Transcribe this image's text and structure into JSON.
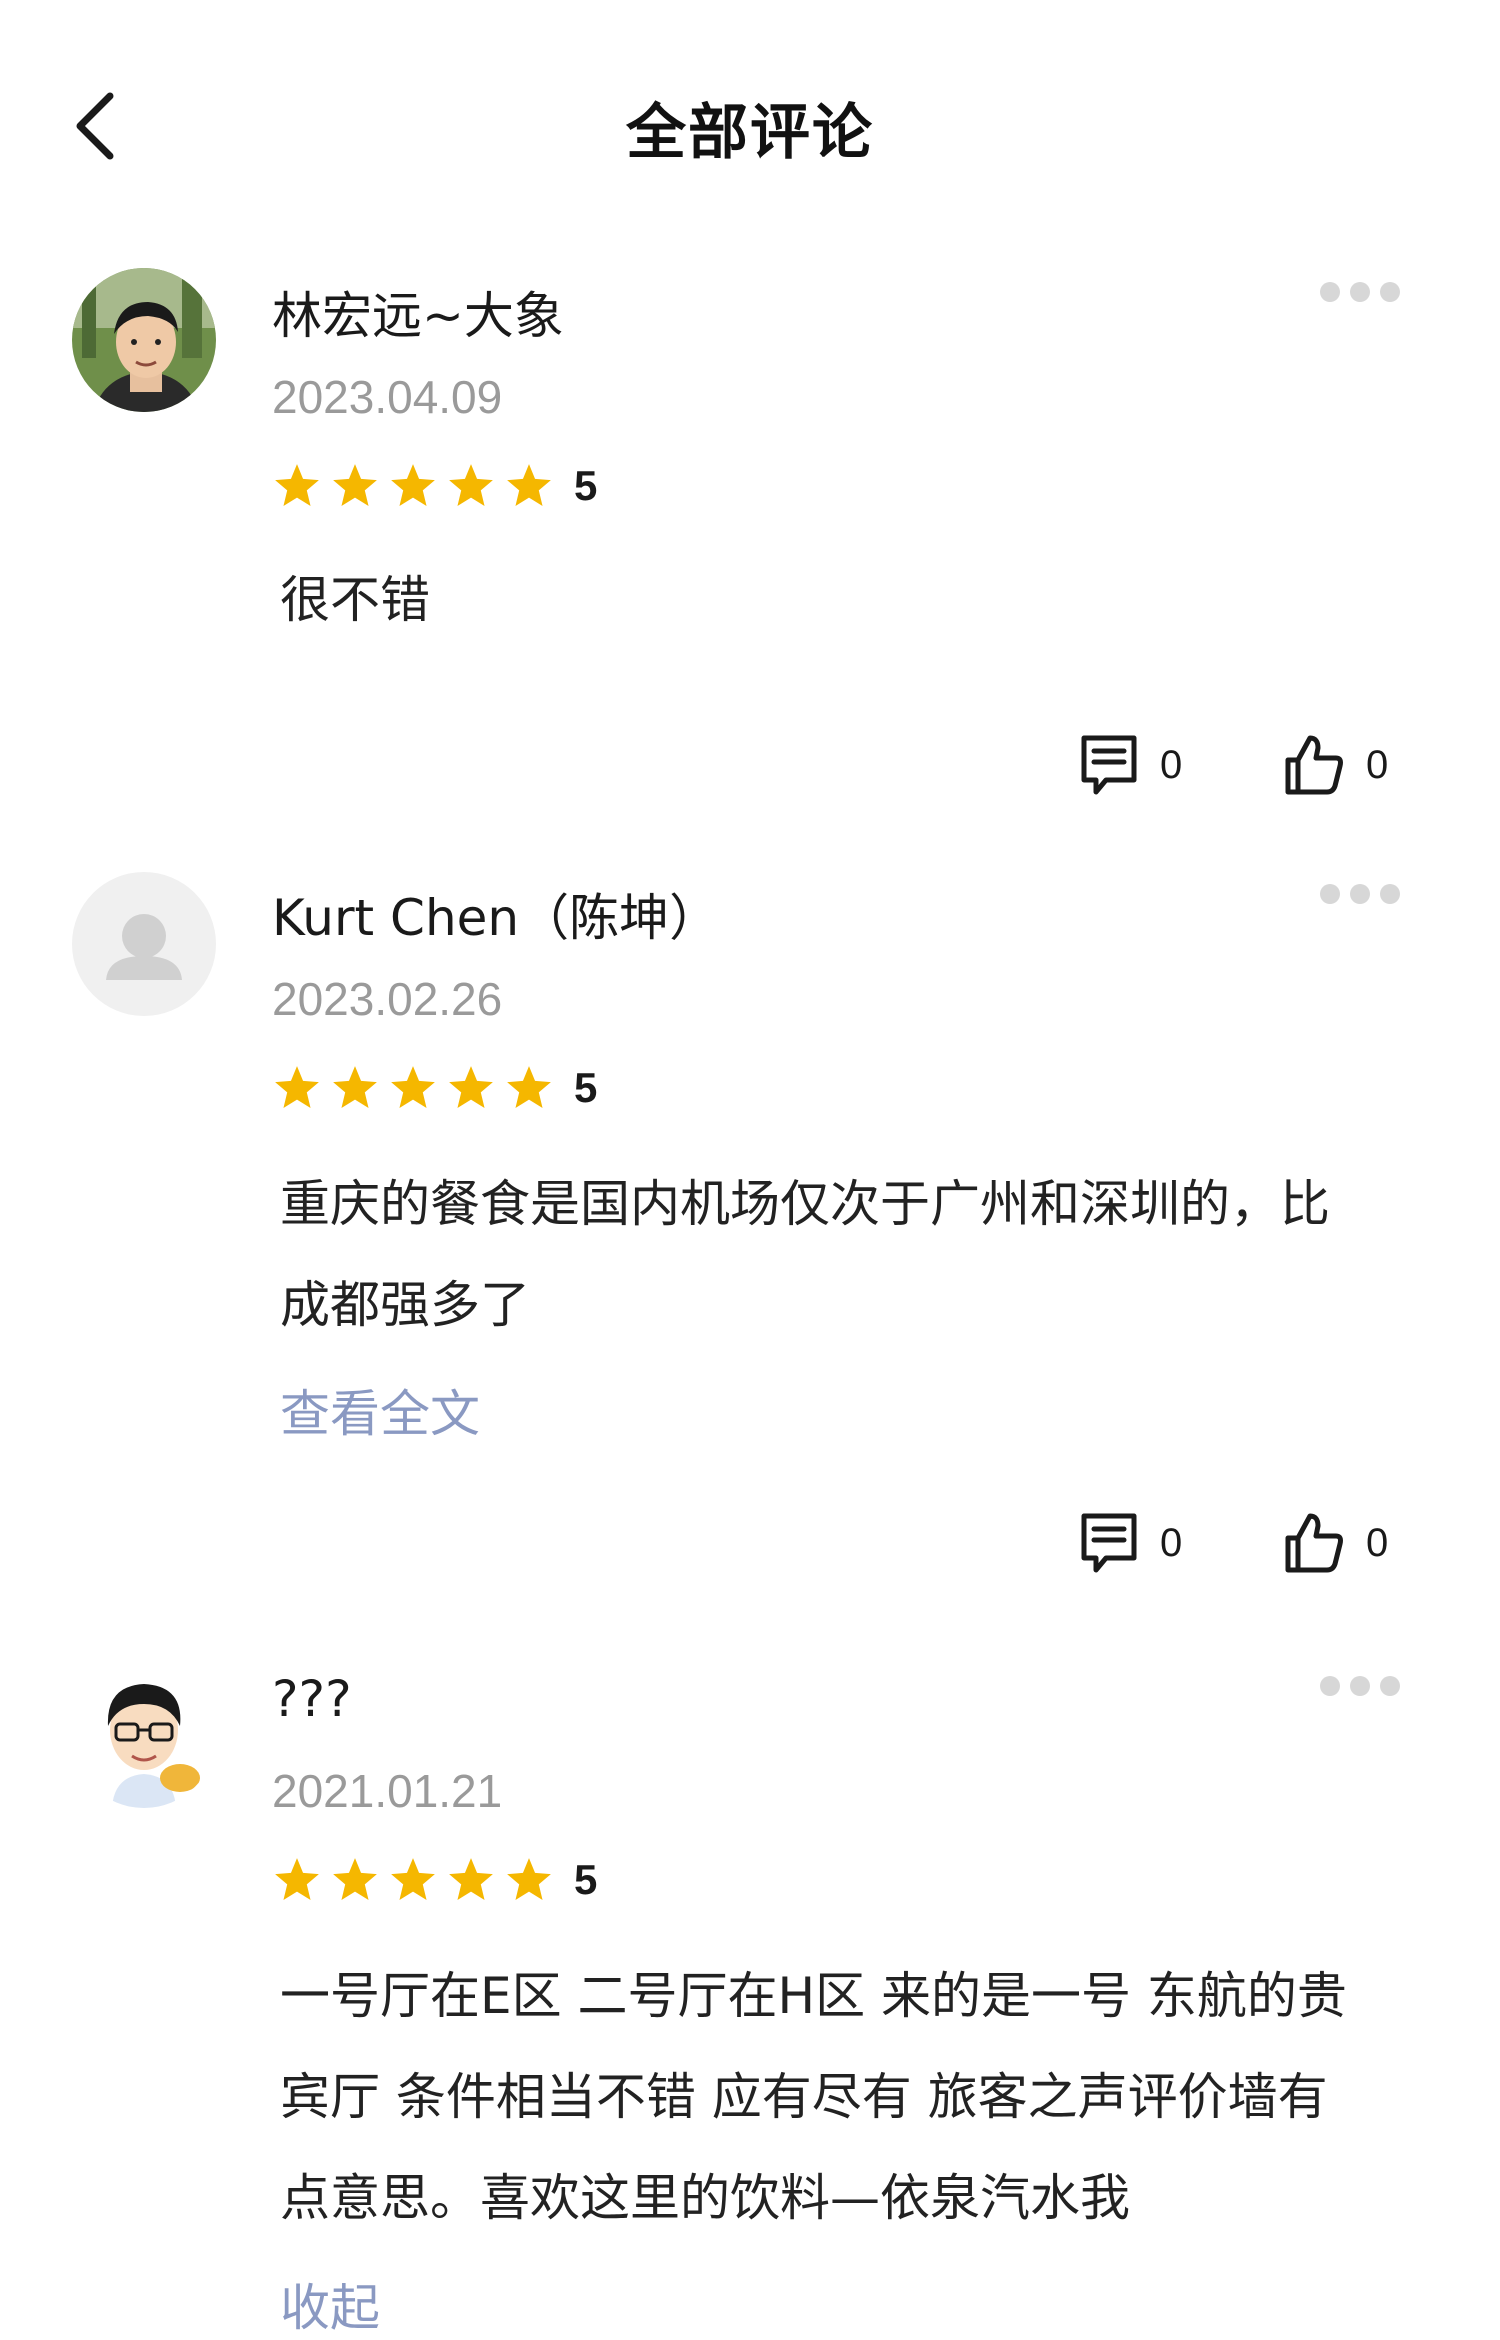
{
  "header": {
    "title": "全部评论"
  },
  "comments": [
    {
      "author": "林宏远~大象",
      "date": "2023.04.09",
      "rating": 5,
      "rating_label": "5",
      "lines": [
        "很不错"
      ],
      "reply_count": "0",
      "like_count": "0"
    },
    {
      "author": "Kurt Chen（陈坤）",
      "date": "2023.02.26",
      "rating": 5,
      "rating_label": "5",
      "lines": [
        "重庆的餐食是国内机场仅次于广州和深圳的，比",
        "成都强多了"
      ],
      "toggle_label": "查看全文",
      "reply_count": "0",
      "like_count": "0"
    },
    {
      "author": "???",
      "date": "2021.01.21",
      "rating": 5,
      "rating_label": "5",
      "lines": [
        "一号厅在E区 二号厅在H区 来的是一号 东航的贵",
        "宾厅 条件相当不错 应有尽有 旅客之声评价墙有",
        "点意思。喜欢这里的饮料—依泉汽水我"
      ],
      "toggle_label": "收起"
    }
  ],
  "colors": {
    "star": "#f5b700",
    "link": "#8a99c2",
    "date": "#9a9a9a",
    "dots": "#d7d7d7"
  }
}
